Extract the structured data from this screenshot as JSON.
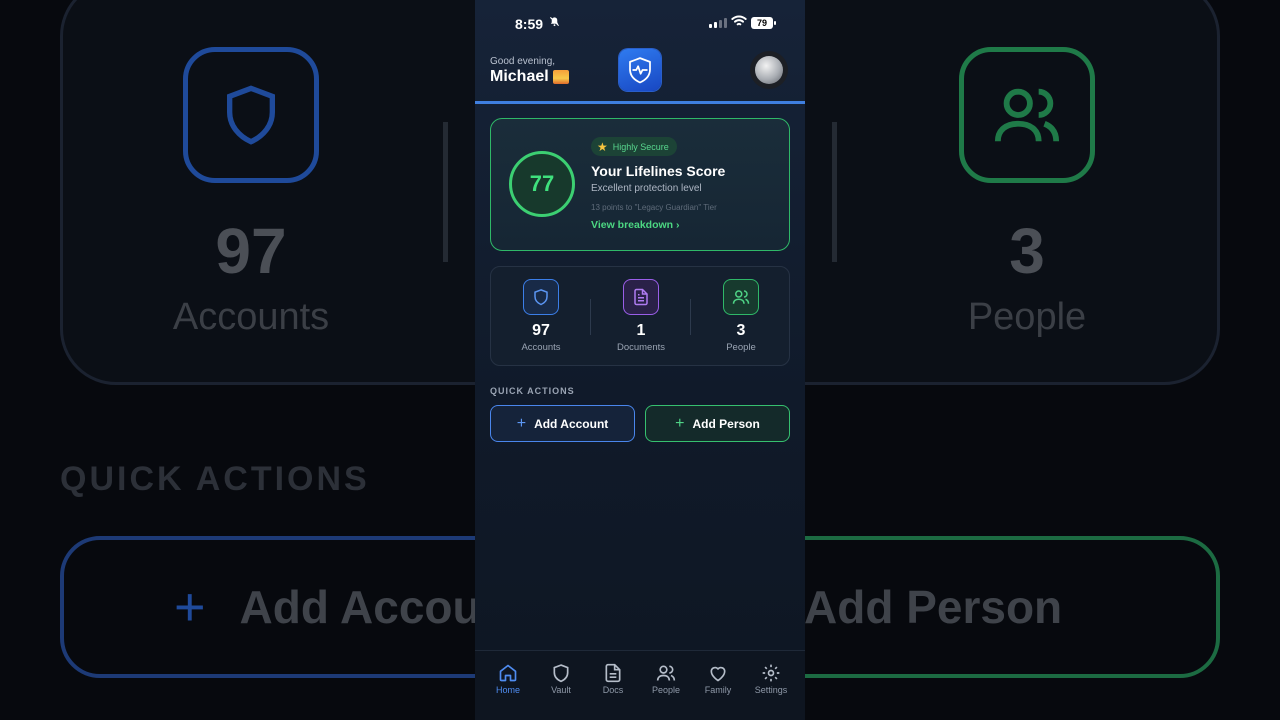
{
  "background": {
    "stats": [
      {
        "number": "97",
        "label": "Accounts"
      },
      {
        "number": "3",
        "label": "People"
      }
    ],
    "quick_actions_label": "QUICK ACTIONS",
    "add_account_label": "Add Accou",
    "add_person_label": "Add Person"
  },
  "status_bar": {
    "time": "8:59",
    "battery": "79"
  },
  "header": {
    "greeting": "Good evening,",
    "user_name": "Michael"
  },
  "score_card": {
    "score": "77",
    "badge": "Highly Secure",
    "title": "Your Lifelines Score",
    "subtitle": "Excellent protection level",
    "hint": "13 points to \"Legacy Guardian\" Tier",
    "link": "View breakdown ›"
  },
  "stats": [
    {
      "number": "97",
      "label": "Accounts",
      "icon": "shield-icon",
      "color": "#3b7ee8"
    },
    {
      "number": "1",
      "label": "Documents",
      "icon": "document-icon",
      "color": "#9a5ee8"
    },
    {
      "number": "3",
      "label": "People",
      "icon": "people-icon",
      "color": "#2fb868"
    }
  ],
  "quick_actions": {
    "label": "QUICK ACTIONS",
    "add_account": "Add Account",
    "add_person": "Add Person"
  },
  "tabs": [
    {
      "label": "Home",
      "icon": "home-icon",
      "active": true
    },
    {
      "label": "Vault",
      "icon": "shield-icon"
    },
    {
      "label": "Docs",
      "icon": "document-icon"
    },
    {
      "label": "People",
      "icon": "people-icon"
    },
    {
      "label": "Family",
      "icon": "heart-icon"
    },
    {
      "label": "Settings",
      "icon": "gear-icon"
    }
  ],
  "colors": {
    "accent_blue": "#3f7fe0",
    "accent_green": "#3ccf72",
    "accent_purple": "#9a5ee8"
  }
}
